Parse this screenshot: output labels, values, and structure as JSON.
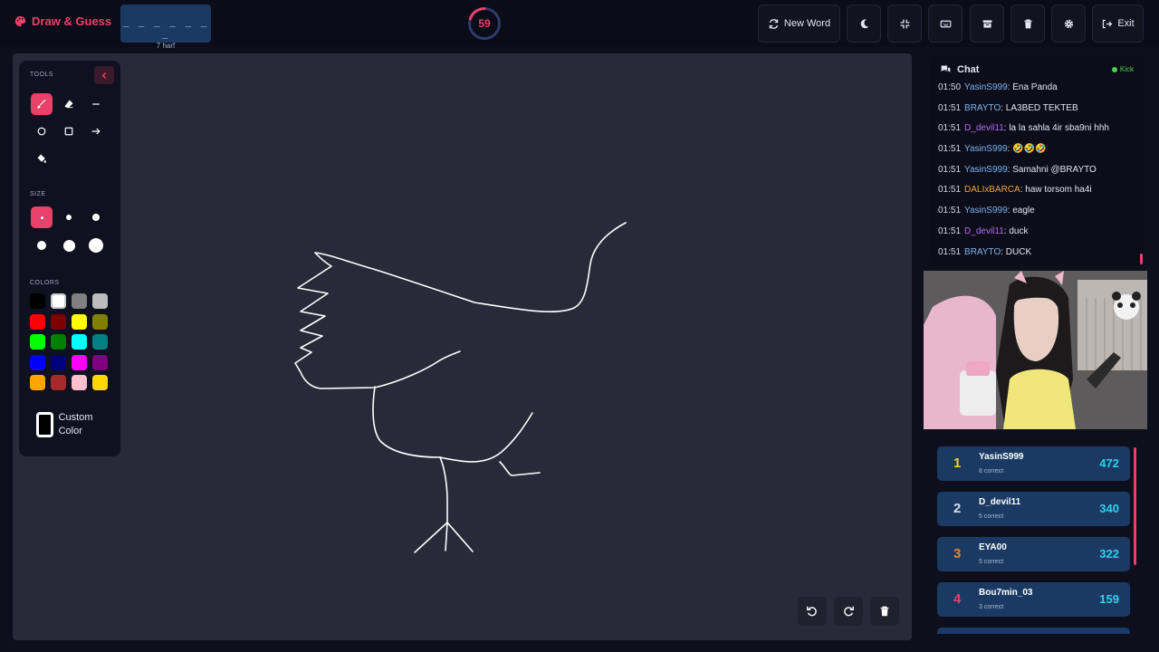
{
  "header": {
    "app_title": "Draw & Guess",
    "word_mask": "_ _ _ _ _ _ _",
    "word_hint": "7 harf",
    "timer_value": "59",
    "timer_progress": 0.2,
    "new_word_label": "New Word",
    "exit_label": "Exit"
  },
  "tools": {
    "title": "TOOLS",
    "size_title": "SIZE",
    "colors_title": "COLORS",
    "custom_color_label": "Custom Color",
    "active_tool": "brush",
    "active_size": 1,
    "colors": [
      "#000000",
      "#ffffff",
      "#808080",
      "#bcbcbc",
      "#ff0000",
      "#800000",
      "#ffff00",
      "#808000",
      "#00ff00",
      "#008000",
      "#00ffff",
      "#008080",
      "#0000ff",
      "#000080",
      "#ff00ff",
      "#800080",
      "#ffa500",
      "#a52a2a",
      "#ffc0cb",
      "#ffd700"
    ]
  },
  "chat": {
    "title": "Chat",
    "status": "Kick",
    "messages": [
      {
        "time": "01:50",
        "user": "YasinS999",
        "user_color": "#7ab6f5",
        "text": "Ena Panda"
      },
      {
        "time": "01:51",
        "user": "BRAYTO",
        "user_color": "#7ab6f5",
        "text": "LA3BED TEKTEB"
      },
      {
        "time": "01:51",
        "user": "D_devil11",
        "user_color": "#b36bf2",
        "text": "la la sahla 4ir sba9ni hhh"
      },
      {
        "time": "01:51",
        "user": "YasinS999",
        "user_color": "#7ab6f5",
        "text": "🤣🤣🤣"
      },
      {
        "time": "01:51",
        "user": "YasinS999",
        "user_color": "#7ab6f5",
        "text": "Samahni @BRAYTO"
      },
      {
        "time": "01:51",
        "user": "DALIxBARCA",
        "user_color": "#f2a33a",
        "text": "haw torsom ha4i"
      },
      {
        "time": "01:51",
        "user": "YasinS999",
        "user_color": "#7ab6f5",
        "text": "eagle"
      },
      {
        "time": "01:51",
        "user": "D_devil11",
        "user_color": "#b36bf2",
        "text": "duck"
      },
      {
        "time": "01:51",
        "user": "BRAYTO",
        "user_color": "#7ab6f5",
        "text": "DUCK"
      }
    ]
  },
  "leaderboard": [
    {
      "rank": "1",
      "name": "YasinS999",
      "sub": "8 correct",
      "score": "472",
      "rank_color": "#f5d21f"
    },
    {
      "rank": "2",
      "name": "D_devil11",
      "sub": "5 correct",
      "score": "340",
      "rank_color": "#d8dde8"
    },
    {
      "rank": "3",
      "name": "EYA00",
      "sub": "5 correct",
      "score": "322",
      "rank_color": "#e08a2e"
    },
    {
      "rank": "4",
      "name": "Bou7min_03",
      "sub": "3 correct",
      "score": "159",
      "rank_color": "#e8416a"
    }
  ],
  "theme": {
    "accent": "#e8416a",
    "score_color": "#2ed1f0",
    "panel_blue": "#1b3a63"
  }
}
